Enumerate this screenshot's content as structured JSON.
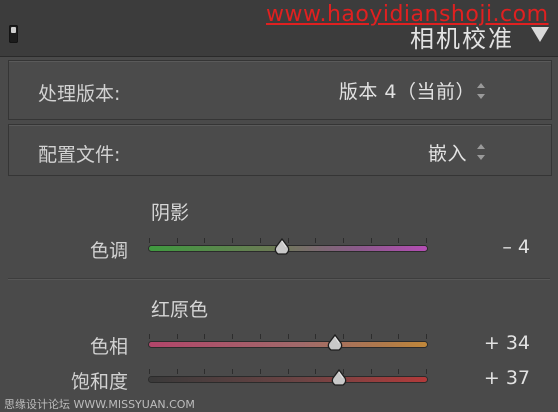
{
  "header": {
    "watermark": "www.haoyidianshoji.com",
    "title": "相机校准"
  },
  "process_version": {
    "label": "处理版本:",
    "value": "版本 4（当前）"
  },
  "profile": {
    "label": "配置文件:",
    "value": "嵌入"
  },
  "shadows": {
    "heading": "阴影",
    "sliders": [
      {
        "label": "色调",
        "value_text": "– 4",
        "value": -4,
        "min": -100,
        "max": 100
      }
    ]
  },
  "red_primary": {
    "heading": "红原色",
    "sliders": [
      {
        "label": "色相",
        "value_text": "+ 34",
        "value": 34,
        "min": -100,
        "max": 100
      },
      {
        "label": "饱和度",
        "value_text": "+ 37",
        "value": 37,
        "min": -100,
        "max": 100
      }
    ]
  },
  "footer": {
    "watermark": "思缘设计论坛 WWW.MISSYUAN.COM"
  },
  "colors": {
    "panel_bg": "#4a4a4a",
    "header_bg": "#3c3c3c",
    "text": "#d6d6d6",
    "watermark_red": "#e02020"
  }
}
